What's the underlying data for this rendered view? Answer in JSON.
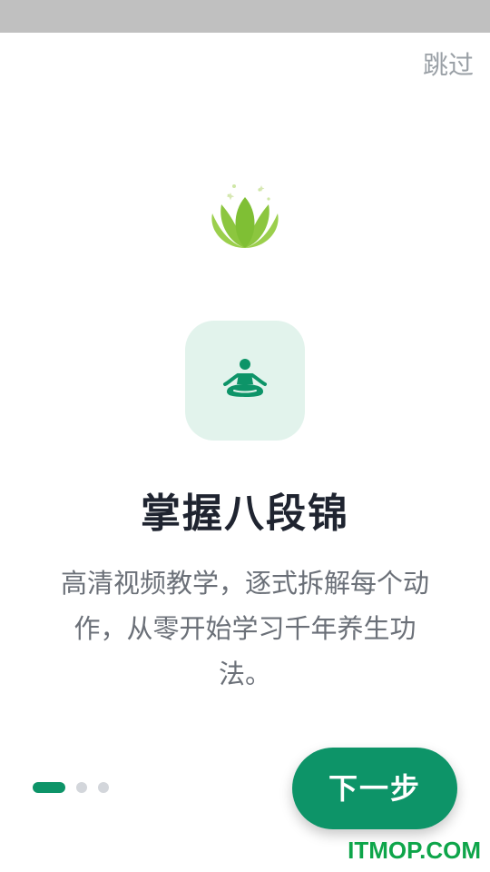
{
  "header": {
    "skip_label": "跳过"
  },
  "slide": {
    "title": "掌握八段锦",
    "description": "高清视频教学，逐式拆解每个动作，从零开始学习千年养生功法。",
    "feature_icon": "meditation-person-icon",
    "decoration_icon": "lotus-icon"
  },
  "pager": {
    "total": 3,
    "active_index": 0
  },
  "footer": {
    "next_label": "下一步"
  },
  "watermark": {
    "text": "ITMOP.COM"
  },
  "colors": {
    "accent": "#0d9468",
    "tile_bg": "#e2f3ec",
    "lotus": "#8cc63f",
    "status_bar": "#c0c0c0"
  }
}
